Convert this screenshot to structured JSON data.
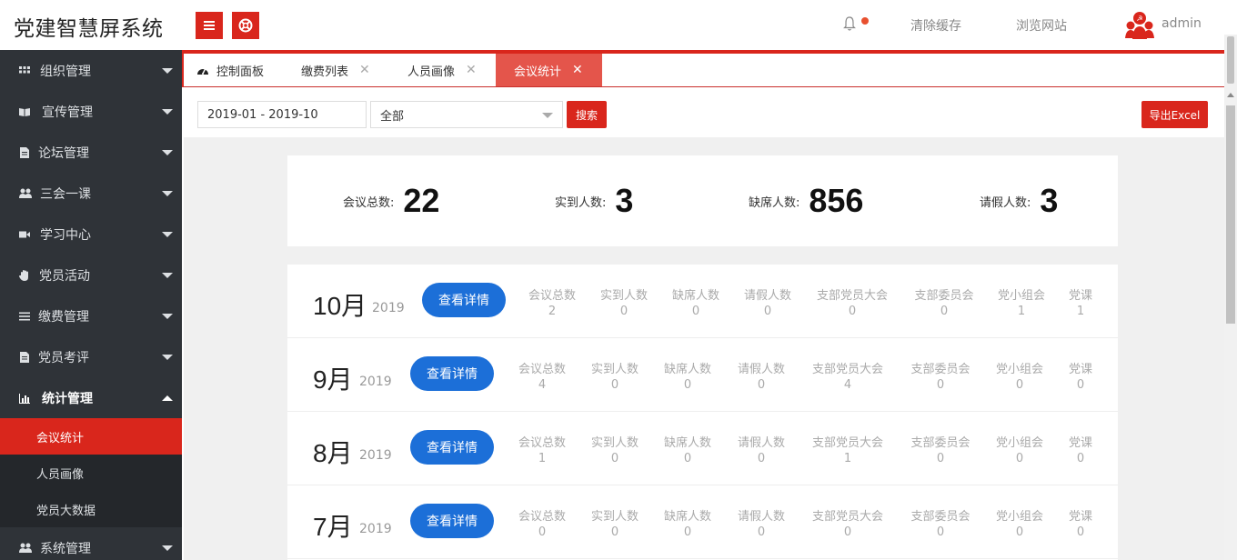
{
  "header": {
    "title": "党建智慧屏系统",
    "clear_cache": "清除缓存",
    "browse_site": "浏览网站",
    "username": "admin",
    "icons": [
      "menu-icon",
      "lifebuoy-icon",
      "bell-icon",
      "avatar-icon"
    ]
  },
  "sidebar": {
    "items": [
      {
        "label": "组织管理",
        "icon": "grid-icon"
      },
      {
        "label": "宣传管理",
        "icon": "book-icon"
      },
      {
        "label": "论坛管理",
        "icon": "file-icon"
      },
      {
        "label": "三会一课",
        "icon": "users-icon"
      },
      {
        "label": "学习中心",
        "icon": "video-icon"
      },
      {
        "label": "党员活动",
        "icon": "hand-icon"
      },
      {
        "label": "缴费管理",
        "icon": "list-icon"
      },
      {
        "label": "党员考评",
        "icon": "file-icon"
      },
      {
        "label": "统计管理",
        "icon": "bar-chart-icon"
      },
      {
        "label": "系统管理",
        "icon": "users-icon"
      }
    ],
    "sub_items": [
      "会议统计",
      "人员画像",
      "党员大数据"
    ]
  },
  "tabs": [
    {
      "label": "控制面板",
      "icon": "dashboard-icon"
    },
    {
      "label": "缴费列表"
    },
    {
      "label": "人员画像"
    },
    {
      "label": "会议统计"
    }
  ],
  "toolbar": {
    "date_range": "2019-01 - 2019-10",
    "select_value": "全部",
    "search_label": "搜索",
    "export_label": "导出Excel"
  },
  "summary": [
    {
      "label": "会议总数:",
      "value": "22"
    },
    {
      "label": "实到人数:",
      "value": "3"
    },
    {
      "label": "缺席人数:",
      "value": "856"
    },
    {
      "label": "请假人数:",
      "value": "3"
    }
  ],
  "detail_label": "查看详情",
  "columns": [
    "会议总数",
    "实到人数",
    "缺席人数",
    "请假人数",
    "支部党员大会",
    "支部委员会",
    "党小组会",
    "党课"
  ],
  "months": [
    {
      "month": "10月",
      "year": "2019",
      "values": [
        "2",
        "0",
        "0",
        "0",
        "0",
        "0",
        "1",
        "1"
      ]
    },
    {
      "month": "9月",
      "year": "2019",
      "values": [
        "4",
        "0",
        "0",
        "0",
        "4",
        "0",
        "0",
        "0"
      ]
    },
    {
      "month": "8月",
      "year": "2019",
      "values": [
        "1",
        "0",
        "0",
        "0",
        "1",
        "0",
        "0",
        "0"
      ]
    },
    {
      "month": "7月",
      "year": "2019",
      "values": [
        "0",
        "0",
        "0",
        "0",
        "0",
        "0",
        "0",
        "0"
      ]
    }
  ],
  "colors": {
    "brand_red": "#d9261c",
    "sidebar_bg": "#2f3338",
    "active_tab": "#e4554b",
    "detail_blue": "#1c6fd8"
  }
}
